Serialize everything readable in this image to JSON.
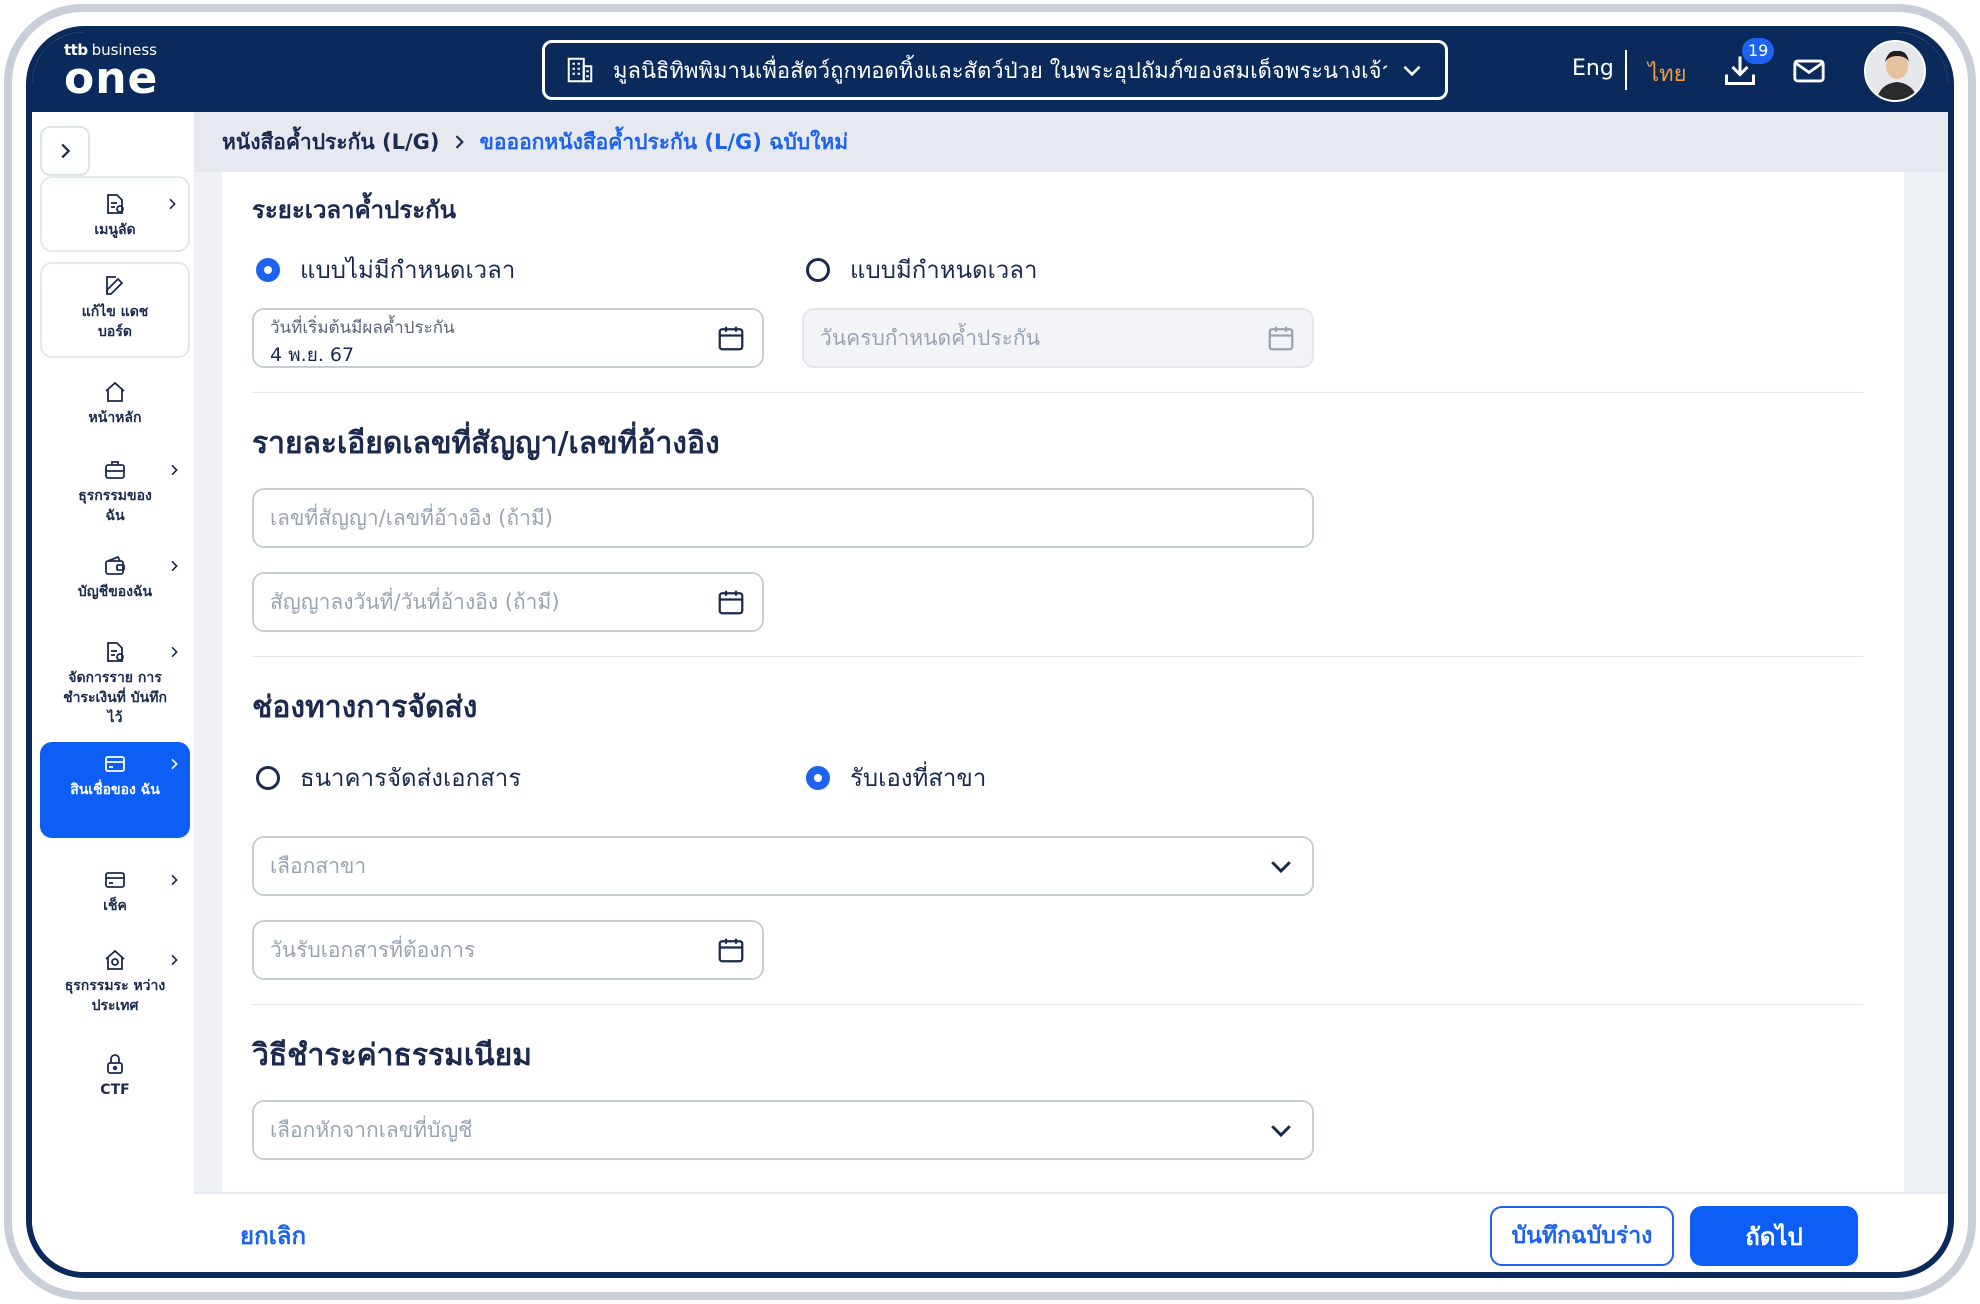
{
  "header": {
    "logo_ttb": "ttb",
    "logo_business": "business",
    "logo_one": "one",
    "company_name": "มูลนิธิทิพพิมานเพื่อสัตว์ถูกทอดทิ้งและสัตว์ป่วย ในพระอุปถัมภ์ของสมเด็จพระนางเจ้า...",
    "lang_eng": "Eng",
    "lang_thai": "ไทย",
    "download_count": "19"
  },
  "sidebar": {
    "items": [
      {
        "label": "เมนูลัด",
        "icon": "shortcut-doc-icon"
      },
      {
        "label": "แก้ไข แดชบอร์ด",
        "icon": "edit-icon"
      },
      {
        "label": "หน้าหลัก",
        "icon": "home-icon"
      },
      {
        "label": "ธุรกรรมของ ฉัน",
        "icon": "briefcase-icon"
      },
      {
        "label": "บัญชีของฉัน",
        "icon": "wallet-icon"
      },
      {
        "label": "จัดการราย การชำระเงินที่ บันทึกไว้",
        "icon": "saved-payment-icon"
      },
      {
        "label": "สินเชื่อของ ฉัน",
        "icon": "loan-card-icon"
      },
      {
        "label": "เช็ค",
        "icon": "cheque-icon"
      },
      {
        "label": "ธุรกรรมระ หว่างประเทศ",
        "icon": "international-icon"
      },
      {
        "label": "CTF",
        "icon": "lock-icon"
      }
    ]
  },
  "breadcrumb": {
    "parent": "หนังสือค้ำประกัน (L/G)",
    "current": "ขอออกหนังสือค้ำประกัน (L/G) ฉบับใหม่"
  },
  "guarantee_period": {
    "title": "ระยะเวลาค้ำประกัน",
    "option_open": "แบบไม่มีกำหนดเวลา",
    "option_fixed": "แบบมีกำหนดเวลา",
    "start_label": "วันที่เริ่มต้นมีผลค้ำประกัน",
    "start_value": "4 พ.ย. 67",
    "end_placeholder": "วันครบกำหนดค้ำประกัน"
  },
  "contract": {
    "title": "รายละเอียดเลขที่สัญญา/เลขที่อ้างอิง",
    "number_placeholder": "เลขที่สัญญา/เลขที่อ้างอิง (ถ้ามี)",
    "date_placeholder": "สัญญาลงวันที่/วันที่อ้างอิง (ถ้ามี)"
  },
  "delivery": {
    "title": "ช่องทางการจัดส่ง",
    "option_bank": "ธนาคารจัดส่งเอกสาร",
    "option_branch": "รับเองที่สาขา",
    "branch_placeholder": "เลือกสาขา",
    "date_placeholder": "วันรับเอกสารที่ต้องการ"
  },
  "fee": {
    "title": "วิธีชำระค่าธรรมเนียม",
    "account_placeholder": "เลือกหักจากเลขที่บัญชี"
  },
  "footer": {
    "cancel": "ยกเลิก",
    "save_draft": "บันทึกฉบับร่าง",
    "next": "ถัดไป"
  },
  "colors": {
    "navy": "#0b2a5c",
    "primary": "#0d5ef4",
    "accent_orange": "#f29c38"
  }
}
